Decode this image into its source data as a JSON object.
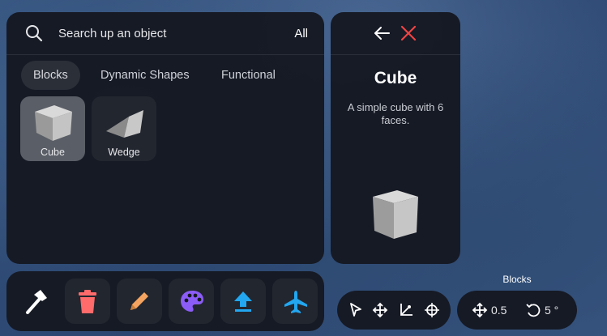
{
  "browser": {
    "search_placeholder": "Search up an object",
    "filter_label": "All",
    "tabs": [
      {
        "label": "Blocks",
        "active": true
      },
      {
        "label": "Dynamic Shapes",
        "active": false
      },
      {
        "label": "Functional",
        "active": false
      }
    ],
    "items": [
      {
        "label": "Cube",
        "icon": "cube-icon",
        "selected": true
      },
      {
        "label": "Wedge",
        "icon": "wedge-icon",
        "selected": false
      }
    ]
  },
  "detail": {
    "title": "Cube",
    "description": "A simple cube with 6 faces.",
    "preview_icon": "cube-icon"
  },
  "toolbar": {
    "tools": [
      {
        "name": "build-hammer",
        "icon": "hammer-icon",
        "color": "#ffffff"
      },
      {
        "name": "delete",
        "icon": "trash-icon",
        "color": "#ff6b6b"
      },
      {
        "name": "edit",
        "icon": "pencil-icon",
        "color": "#f4a460"
      },
      {
        "name": "paint",
        "icon": "palette-icon",
        "color": "#8b5cf6"
      },
      {
        "name": "upload",
        "icon": "upload-icon",
        "color": "#22a7f0"
      },
      {
        "name": "fly",
        "icon": "airplane-icon",
        "color": "#22a7f0"
      }
    ]
  },
  "mode_label": "Blocks",
  "transform_tools": [
    "select-arrow-icon",
    "move-icon",
    "scale-icon",
    "rotate-icon"
  ],
  "snap": {
    "move_value": "0.5",
    "rotate_value": "5 °"
  },
  "colors": {
    "panel_bg": "#15181f",
    "close_red": "#ef4444",
    "accent_blue": "#22a7f0"
  }
}
